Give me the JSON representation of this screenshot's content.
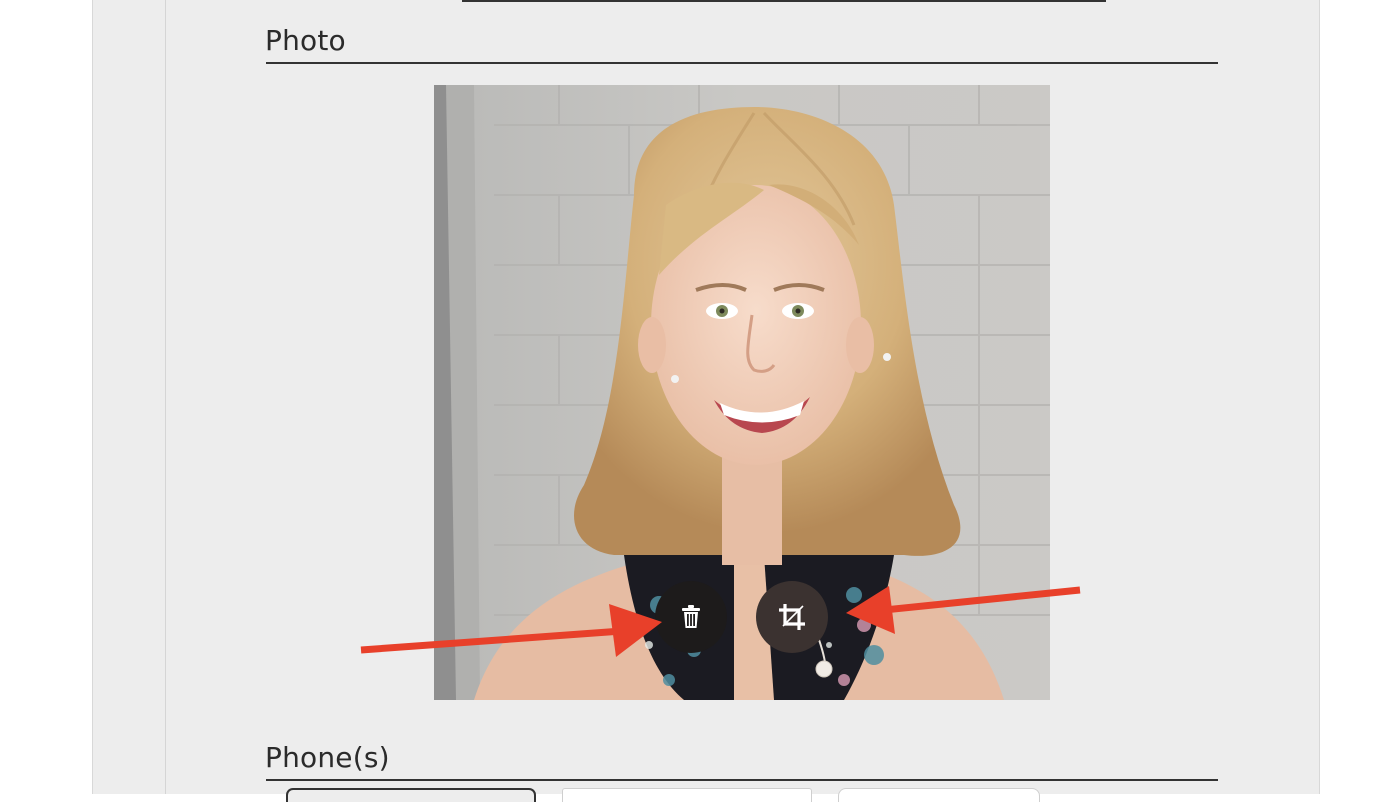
{
  "sections": {
    "photo": {
      "title": "Photo"
    },
    "phones": {
      "title": "Phone(s)"
    }
  },
  "photo_actions": {
    "delete": {
      "icon": "trash-icon"
    },
    "crop": {
      "icon": "crop-icon"
    }
  },
  "annotations": {
    "arrow_color": "#e8402a"
  },
  "colors": {
    "panel_background": "#ededed",
    "heading_text": "#2b2b2b",
    "rule": "#333333",
    "delete_button": "#1d1b1b",
    "crop_button": "#3b3230"
  }
}
